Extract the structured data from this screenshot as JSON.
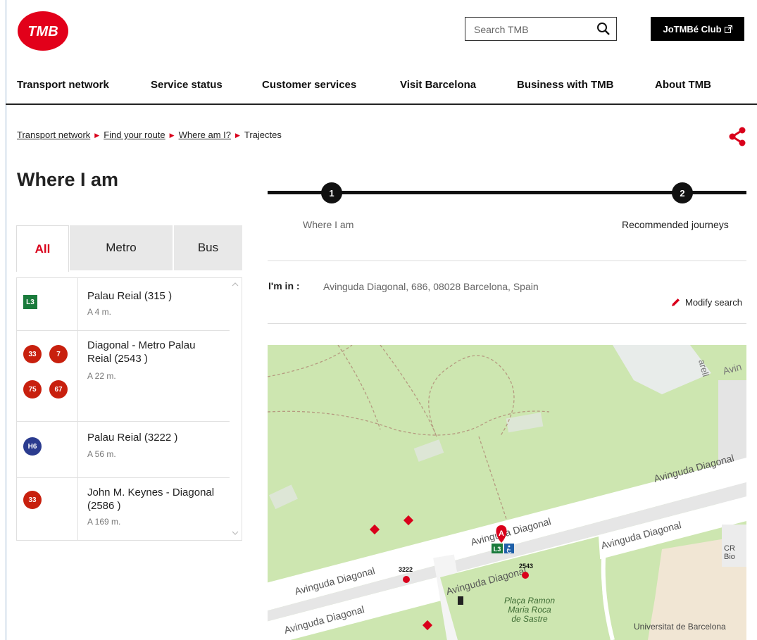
{
  "header": {
    "logo_text": "TMB",
    "search_placeholder": "Search TMB",
    "club_label": "JoTMBé Club"
  },
  "nav": {
    "items": [
      "Transport network",
      "Service status",
      "Customer services",
      "Visit Barcelona",
      "Business with TMB",
      "About TMB"
    ]
  },
  "breadcrumb": {
    "items": [
      "Transport network",
      "Find your route",
      "Where am I?",
      "Trajectes"
    ]
  },
  "page_title": "Where I am",
  "tabs": [
    "All",
    "Metro",
    "Bus"
  ],
  "stops": [
    {
      "name": "Palau Reial (315 )",
      "distance": "A 4 m.",
      "lines": [
        "L3"
      ]
    },
    {
      "name": "Diagonal - Metro Palau Reial (2543 )",
      "distance": "A 22 m.",
      "lines": [
        "33",
        "7",
        "75",
        "67"
      ]
    },
    {
      "name": "Palau Reial (3222 )",
      "distance": "A 56 m.",
      "lines": [
        "H6"
      ]
    },
    {
      "name": "John M. Keynes - Diagonal (2586 )",
      "distance": "A 169 m.",
      "lines": [
        "33"
      ]
    }
  ],
  "steps": [
    {
      "number": "1",
      "label": "Where I am"
    },
    {
      "number": "2",
      "label": "Recommended journeys"
    }
  ],
  "location": {
    "label": "I'm in :",
    "address": "Avinguda Diagonal, 686, 08028 Barcelona, Spain",
    "modify_label": "Modify search"
  },
  "map": {
    "labels": [
      "Avinguda Diagonal",
      "Avinguda Diagonal",
      "Avinguda Diagonal",
      "Avinguda Diagonal",
      "Avinguda Diagonal",
      "Avinguda Diagonal",
      "Plaça Ramon Maria Roca de Sastre",
      "Universitat de Barcelona - Facultat de Biologia",
      "CR Bio",
      "Avin",
      "arell"
    ],
    "marker_label": "A",
    "stop_codes": [
      "3222",
      "2543"
    ],
    "line_badge": "L3"
  },
  "colors": {
    "brand_red": "#d9001b",
    "metro_green": "#1a7b3c",
    "bus_red": "#c8200e",
    "bus_blue": "#2b3c8f",
    "park_green": "#cde6b0"
  }
}
